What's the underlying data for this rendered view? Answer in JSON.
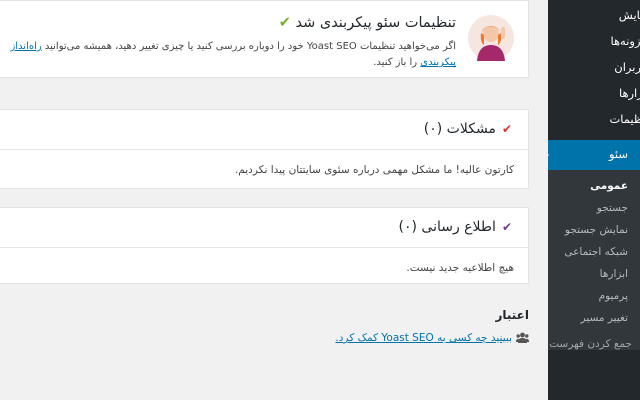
{
  "sidebar": {
    "items": [
      {
        "label": "نمایش"
      },
      {
        "label": "افزونه‌ها"
      },
      {
        "label": "کاربران"
      },
      {
        "label": "ابزارها"
      },
      {
        "label": "تنظیمات"
      }
    ],
    "current": {
      "label": "سئو"
    },
    "submenu": [
      {
        "label": "عمومی"
      },
      {
        "label": "جستجو"
      },
      {
        "label": "نمایش جستجو"
      },
      {
        "label": "شبکه اجتماعی"
      },
      {
        "label": "ابزارها"
      },
      {
        "label": "پرمیوم"
      },
      {
        "label": "تغییر مسیر"
      }
    ],
    "collapse_label": "جمع کردن فهرست"
  },
  "configured": {
    "title": "تنظیمات سئو پیکربندی شد",
    "text_before_link1": "اگر می‌خواهید تنظیمات Yoast SEO خود را دوباره بررسی کنید یا چیزی تغییر دهید، همیشه می‌توانید ",
    "link1": "راه‌انداز پیکربندی",
    "text_after_link1": " را باز کنید."
  },
  "problems": {
    "title": "مشکلات (۰)",
    "body": "کارتون عالیه! ما مشکل مهمی درباره سئوی سایتتان پیدا نکردیم."
  },
  "notifications": {
    "title": "اطلاع رسانی (۰)",
    "body": "هیچ اطلاعیه جدید نیست."
  },
  "credits": {
    "title": "اعتبار",
    "link": "ببینید چه کسی به Yoast SEO کمک کرد."
  },
  "colors": {
    "sidebar_bg": "#23282d",
    "sidebar_active": "#0073aa",
    "link": "#0073aa",
    "check_green": "#77b227",
    "check_red": "#dc3232",
    "check_purple": "#6b3d8c"
  }
}
